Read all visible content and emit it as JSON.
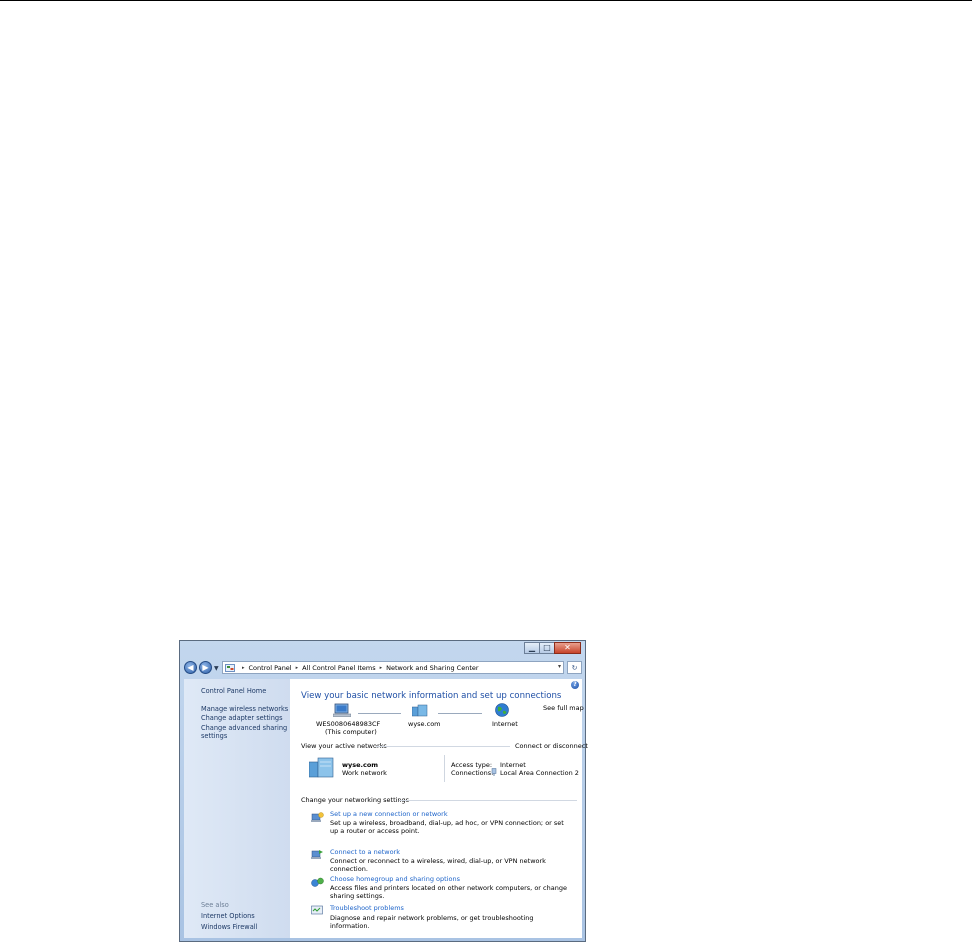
{
  "window": {
    "caption_buttons": {
      "minimize": "▁",
      "maximize": "□",
      "close": "✕"
    }
  },
  "address_bar": {
    "breadcrumb": [
      "Control Panel",
      "All Control Panel Items",
      "Network and Sharing Center"
    ],
    "separator": "▸"
  },
  "sidebar": {
    "home": "Control Panel Home",
    "links": [
      "Manage wireless networks",
      "Change adapter settings",
      "Change advanced sharing",
      "settings"
    ],
    "see_also_label": "See also",
    "see_also": [
      "Internet Options",
      "Windows Firewall"
    ]
  },
  "main": {
    "title": "View your basic network information and set up connections",
    "see_full_map": "See full map",
    "map": {
      "computer_name": "WES0080648983CF",
      "computer_sub": "(This computer)",
      "network_name": "wyse.com",
      "internet": "Internet"
    },
    "active_networks": {
      "header": "View your active networks",
      "connect_link": "Connect or disconnect",
      "network_name": "wyse.com",
      "network_type": "Work network",
      "access_type_label": "Access type:",
      "access_type_value": "Internet",
      "connections_label": "Connections:",
      "connections_value": "Local Area Connection 2"
    },
    "change_settings": {
      "header": "Change your networking settings",
      "tasks": [
        {
          "link": "Set up a new connection or network",
          "desc": "Set up a wireless, broadband, dial-up, ad hoc, or VPN connection; or set up a router or access point."
        },
        {
          "link": "Connect to a network",
          "desc": "Connect or reconnect to a wireless, wired, dial-up, or VPN network connection."
        },
        {
          "link": "Choose homegroup and sharing options",
          "desc": "Access files and printers located on other network computers, or change sharing settings."
        },
        {
          "link": "Troubleshoot problems",
          "desc": "Diagnose and repair network problems, or get troubleshooting information."
        }
      ]
    }
  }
}
